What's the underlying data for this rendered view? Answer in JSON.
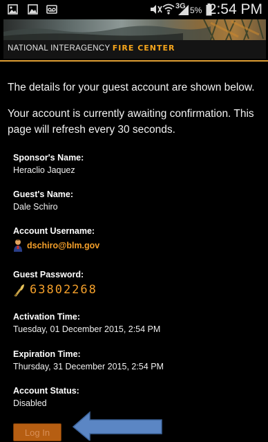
{
  "status_bar": {
    "battery_percent": "5%",
    "network": "3G",
    "time": "2:54 PM",
    "icons": [
      "image-icon",
      "gallery-icon",
      "voicemail-icon",
      "mute-icon",
      "wifi-icon",
      "signal-icon",
      "battery-icon"
    ]
  },
  "header": {
    "org_prefix": "NATIONAL INTERAGENCY ",
    "org_accent": "FIRE CENTER",
    "accent_color": "#f5a51c"
  },
  "intro": {
    "line1": "The details for your guest account are shown below.",
    "line2": "Your account is currently awaiting confirmation. This page will refresh every 30 seconds."
  },
  "fields": {
    "sponsor": {
      "label": "Sponsor's Name:",
      "value": "Heraclio Jaquez"
    },
    "guest": {
      "label": "Guest's Name:",
      "value": "Dale Schiro"
    },
    "username": {
      "label": "Account Username:",
      "value": "dschiro@blm.gov",
      "icon": "user-icon"
    },
    "password": {
      "label": "Guest Password:",
      "value": "63802268",
      "icon": "key-icon"
    },
    "activation": {
      "label": "Activation Time:",
      "value": "Tuesday, 01 December 2015, 2:54 PM"
    },
    "expiration": {
      "label": "Expiration Time:",
      "value": "Thursday, 31 December 2015, 2:54 PM"
    },
    "status": {
      "label": "Account Status:",
      "value": "Disabled"
    }
  },
  "login_button": {
    "label": "Log In",
    "color": "#b65e12"
  },
  "annotation": {
    "arrow_color": "#5b86c4",
    "icon": "arrow-left-icon"
  }
}
